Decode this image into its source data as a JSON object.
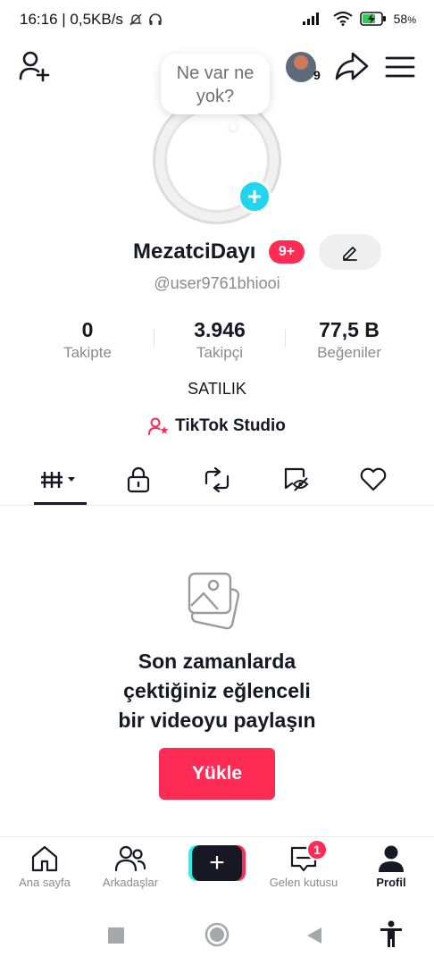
{
  "status_bar": {
    "time_speed": "16:16 | 0,5KB/s",
    "battery": "58",
    "battery_unit": "%"
  },
  "top_bar": {
    "avatar_count": "9"
  },
  "profile": {
    "bubble_text": "Ne var ne yok?",
    "username": "MezatciDayı",
    "notif_badge": "9+",
    "handle": "@user9761bhiooi",
    "bio": "SATILIK",
    "studio_label": "TikTok Studio"
  },
  "stats": [
    {
      "value": "0",
      "label": "Takipte"
    },
    {
      "value": "3.946",
      "label": "Takipçi"
    },
    {
      "value": "77,5 B",
      "label": "Beğeniler"
    }
  ],
  "empty_state": {
    "message_line1": "Son zamanlarda",
    "message_line2": "çektiğiniz eğlenceli",
    "message_line3": "bir videoyu paylaşın",
    "upload_label": "Yükle"
  },
  "bottom_nav": {
    "home": "Ana sayfa",
    "friends": "Arkadaşlar",
    "inbox": "Gelen kutusu",
    "inbox_badge": "1",
    "profile": "Profil"
  },
  "colors": {
    "accent": "#fe2c55",
    "cyan": "#25f4ee",
    "plus_blue": "#20d5ec",
    "text": "#161823",
    "muted": "#8a8b91"
  }
}
